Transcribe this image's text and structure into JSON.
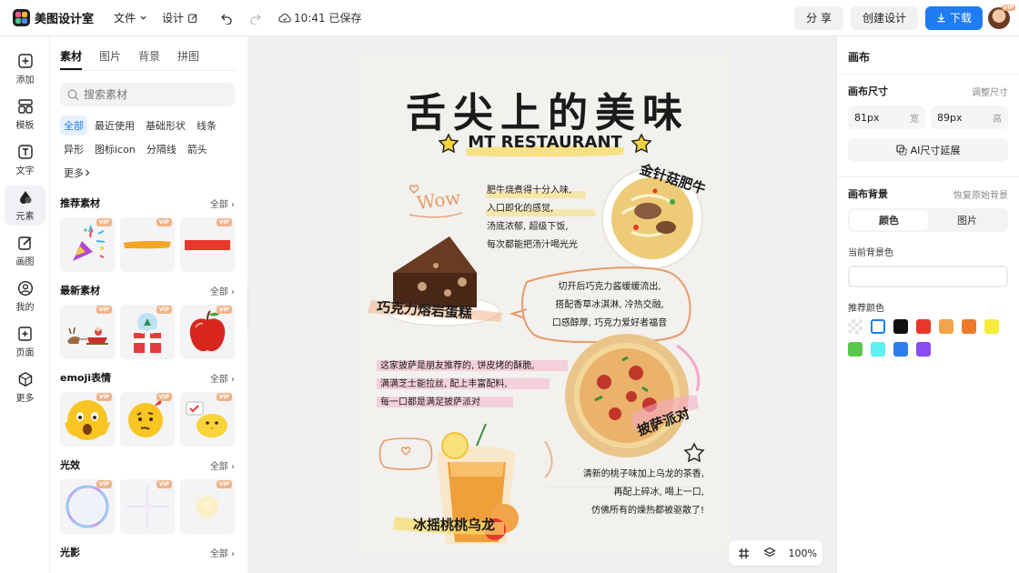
{
  "app": {
    "name": "美图设计室"
  },
  "topbar": {
    "file_menu": "文件",
    "design_menu": "设计",
    "save_status": "10:41 已保存",
    "share": "分 享",
    "create": "创建设计",
    "download": "下载",
    "avatar_badge": "VIP"
  },
  "leftnav": {
    "items": [
      {
        "label": "添加",
        "icon": "plus-square-icon"
      },
      {
        "label": "模板",
        "icon": "template-icon"
      },
      {
        "label": "文字",
        "icon": "text-icon"
      },
      {
        "label": "元素",
        "icon": "shapes-icon"
      },
      {
        "label": "画图",
        "icon": "draw-icon"
      },
      {
        "label": "我的",
        "icon": "user-icon"
      },
      {
        "label": "页面",
        "icon": "page-add-icon"
      },
      {
        "label": "更多",
        "icon": "cube-icon"
      }
    ],
    "active": "元素"
  },
  "panel": {
    "tabs": [
      "素材",
      "图片",
      "背景",
      "拼图"
    ],
    "active_tab": "素材",
    "search_placeholder": "搜索素材",
    "chips": [
      "全部",
      "最近使用",
      "基础形状",
      "线条",
      "异形",
      "图标icon",
      "分隔线",
      "箭头",
      "更多"
    ],
    "active_chip": "全部",
    "all_label": "全部",
    "vip": "VIP",
    "sections": [
      {
        "title": "推荐素材",
        "items": [
          "party-popper",
          "orange-brush-stroke",
          "red-rectangle"
        ]
      },
      {
        "title": "最新素材",
        "items": [
          "santa-sleigh",
          "snow-globe-gift",
          "red-apple"
        ]
      },
      {
        "title": "emoji表情",
        "items": [
          "shocked-emoji",
          "thinking-emoji",
          "chick-emoji"
        ]
      },
      {
        "title": "光效",
        "items": [
          "bubble-ring",
          "star-sparkle",
          "soft-glow"
        ]
      },
      {
        "title": "光影",
        "items": []
      }
    ]
  },
  "poster": {
    "title": "舌尖上的美味",
    "subtitle": "MT RESTAURANT",
    "wow": "Wow",
    "label_beef": "金针菇肥牛",
    "text_beef": [
      "肥牛烧煮得十分入味,",
      "入口即化的感觉,",
      "汤底浓郁, 超级下饭,",
      "每次都能把汤汁喝光光"
    ],
    "label_cake": "巧克力熔岩蛋糕",
    "text_cake": [
      "切开后巧克力酱缓缓流出,",
      "搭配香草冰淇淋, 冷热交融,",
      "口感醇厚, 巧克力爱好者福音"
    ],
    "text_pizza": [
      "这家披萨是朋友推荐的, 饼皮烤的酥脆,",
      "满满芝士能拉丝, 配上丰富配料,",
      "每一口都是满足披萨派对"
    ],
    "label_pizza": "披萨派对",
    "text_tea": [
      "清新的桃子味加上乌龙的茶香,",
      "再配上碎冰, 喝上一口,",
      "仿佛所有的燥热都被驱散了!"
    ],
    "label_tea": "冰摇桃桃乌龙"
  },
  "zoom": {
    "value": "100%"
  },
  "rightpanel": {
    "title": "画布",
    "size_label": "画布尺寸",
    "adjust_size": "调整尺寸",
    "width_value": "81px",
    "width_unit": "宽",
    "height_value": "89px",
    "height_unit": "高",
    "ai_button": "AI尺寸延展",
    "bg_label": "画布背景",
    "restore_bg": "恢复原始背景",
    "seg_color": "颜色",
    "seg_image": "图片",
    "current_bg": "当前背景色",
    "recommend": "推荐颜色",
    "swatches": [
      "transparent",
      "#ffffff",
      "#111111",
      "#e8382c",
      "#f2a44b",
      "#ee7a2a",
      "#f7ec3d",
      "#55c84a",
      "#5ff0f0",
      "#2a7ef0",
      "#8a4cf0"
    ]
  },
  "colors": {
    "accent": "#1f7cf3",
    "vip": "#f0b489"
  }
}
